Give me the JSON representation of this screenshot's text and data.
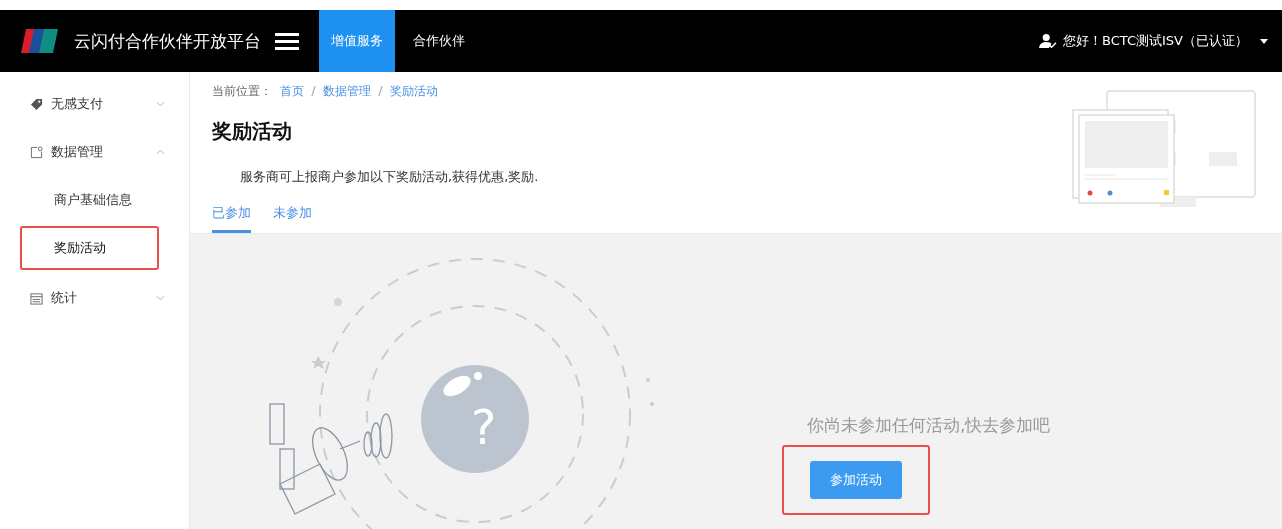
{
  "header": {
    "title": "云闪付合作伙伴开放平台",
    "nav": [
      {
        "label": "增值服务",
        "selected": true
      },
      {
        "label": "合作伙伴",
        "selected": false
      }
    ],
    "user": "您好！BCTC测试ISV（已认证）"
  },
  "sidebar": {
    "items": [
      {
        "label": "无感支付",
        "kind": "tag",
        "expanded": false
      },
      {
        "label": "数据管理",
        "kind": "doc",
        "expanded": true,
        "children": [
          {
            "label": "商户基础信息",
            "selected": false,
            "highlighted": false
          },
          {
            "label": "奖励活动",
            "selected": true,
            "highlighted": true
          }
        ]
      },
      {
        "label": "统计",
        "kind": "calendar",
        "expanded": false
      }
    ]
  },
  "breadcrumb": {
    "prefix": "当前位置：",
    "items": [
      "首页",
      "数据管理",
      "奖励活动"
    ]
  },
  "page_title": "奖励活动",
  "description": "服务商可上报商户参加以下奖励活动,获得优惠,奖励.",
  "tabs": [
    {
      "label": "已参加",
      "selected": true
    },
    {
      "label": "未参加",
      "selected": false
    }
  ],
  "empty_state": {
    "symbol": "?",
    "message": "你尚未参加任何活动,快去参加吧",
    "button": {
      "label": "参加活动",
      "highlighted": true
    }
  }
}
